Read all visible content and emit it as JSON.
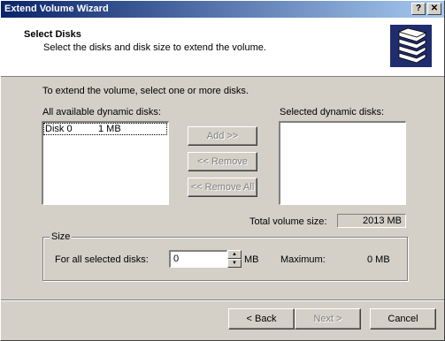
{
  "window": {
    "title": "Extend Volume Wizard",
    "close_glyph": "?"
  },
  "header": {
    "title": "Select Disks",
    "subtitle": "Select the disks and disk size to extend the volume."
  },
  "instruction": "To extend the volume, select one or more disks.",
  "available": {
    "label": "All available dynamic disks:",
    "items": [
      {
        "name": "Disk 0",
        "size": "1 MB"
      }
    ]
  },
  "selected": {
    "label": "Selected dynamic disks:"
  },
  "buttons": {
    "add": "Add >>",
    "remove": "<< Remove",
    "remove_all": "<< Remove All"
  },
  "total": {
    "label": "Total volume size:",
    "value": "2013 MB"
  },
  "size_group": {
    "label": "Size",
    "for_all_label": "For all selected disks:",
    "value": "0",
    "unit": "MB",
    "max_label": "Maximum:",
    "max_value": "0 MB"
  },
  "footer": {
    "back": "< Back",
    "next": "Next >",
    "cancel": "Cancel"
  },
  "colors": {
    "title_start": "#0a246a",
    "title_end": "#a6caf0",
    "face": "#d4d0c8",
    "logo": "#1f2c6d"
  }
}
